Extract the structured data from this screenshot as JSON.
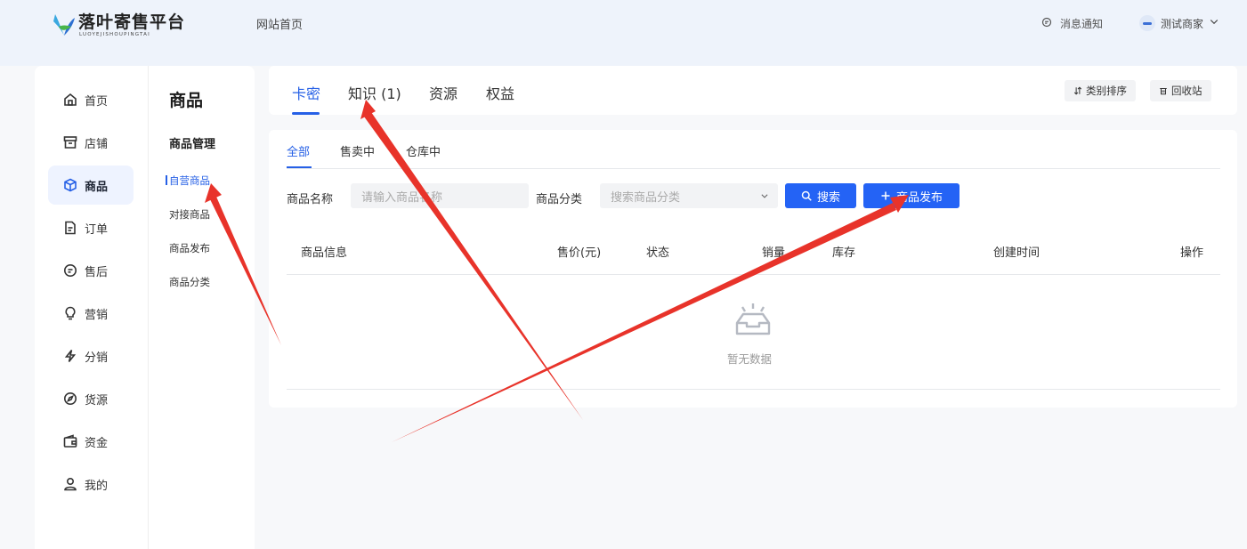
{
  "header": {
    "logo_text": "落叶寄售平台",
    "logo_sub": "LUOYEJISHOUPINGTAI",
    "home_link": "网站首页",
    "notice": "消息通知",
    "merchant": "测试商家"
  },
  "nav": {
    "items": [
      {
        "label": "首页",
        "icon": "home-icon"
      },
      {
        "label": "店铺",
        "icon": "store-icon"
      },
      {
        "label": "商品",
        "icon": "box-icon",
        "active": true
      },
      {
        "label": "订单",
        "icon": "document-icon"
      },
      {
        "label": "售后",
        "icon": "chat-icon"
      },
      {
        "label": "营销",
        "icon": "bulb-icon"
      },
      {
        "label": "分销",
        "icon": "lightning-icon"
      },
      {
        "label": "货源",
        "icon": "compass-icon"
      },
      {
        "label": "资金",
        "icon": "wallet-icon"
      },
      {
        "label": "我的",
        "icon": "user-icon"
      }
    ]
  },
  "subnav": {
    "title": "商品",
    "group": "商品管理",
    "items": [
      "自营商品",
      "对接商品",
      "商品发布",
      "商品分类"
    ],
    "active_index": 0
  },
  "tabs": {
    "items": [
      "卡密",
      "知识 (1)",
      "资源",
      "权益"
    ],
    "active_index": 0,
    "sort_button": "类别排序",
    "recycle_button": "回收站"
  },
  "subtabs": {
    "items": [
      "全部",
      "售卖中",
      "仓库中"
    ],
    "active_index": 0
  },
  "filters": {
    "name_label": "商品名称",
    "name_placeholder": "请输入商品名称",
    "category_label": "商品分类",
    "category_placeholder": "搜索商品分类",
    "search_button": "搜索",
    "publish_button": "商品发布"
  },
  "table": {
    "columns": [
      "商品信息",
      "售价(元)",
      "状态",
      "销量",
      "库存",
      "创建时间",
      "操作"
    ],
    "empty_text": "暂无数据"
  },
  "colors": {
    "accent": "#2660e6",
    "button": "#2463f5",
    "annotation_arrow": "#e8332a"
  }
}
